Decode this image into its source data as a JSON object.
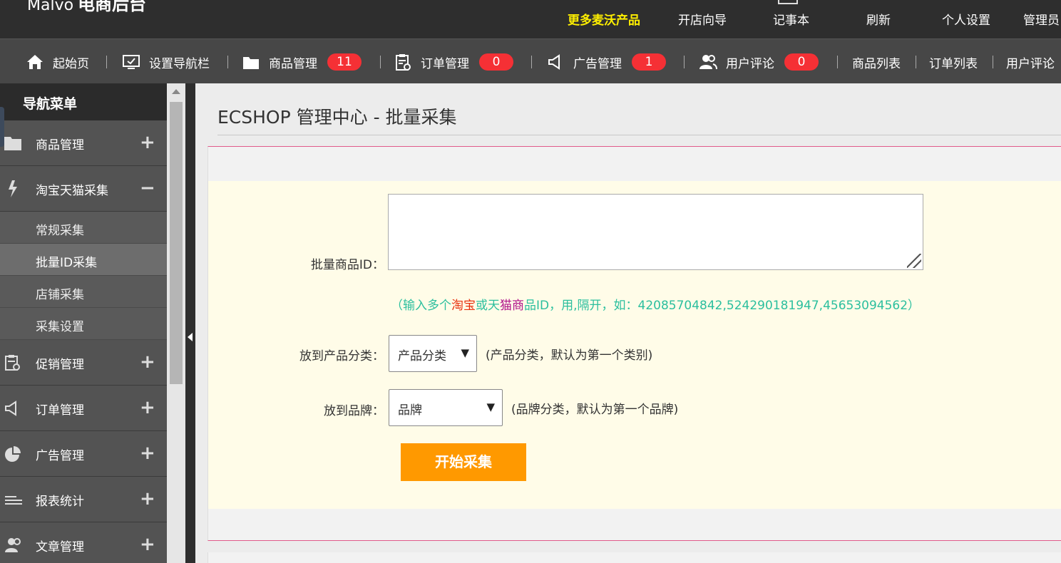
{
  "topbar": {
    "logo_text": "Malvo",
    "logo_brand": "电商后台",
    "nav": [
      {
        "label": "更多麦沃产品",
        "highlight": true
      },
      {
        "label": "开店向导"
      },
      {
        "label": "记事本"
      },
      {
        "label": "刷新"
      },
      {
        "label": "个人设置"
      },
      {
        "label": "管理员"
      }
    ]
  },
  "subbar": {
    "items": [
      {
        "label": "起始页",
        "icon": "home-icon"
      },
      {
        "label": "设置导航栏",
        "icon": "monitor-check-icon"
      },
      {
        "label": "商品管理",
        "icon": "folder-icon",
        "badge": "11"
      },
      {
        "label": "订单管理",
        "icon": "clipboard-icon",
        "badge": "0"
      },
      {
        "label": "广告管理",
        "icon": "megaphone-icon",
        "badge": "1"
      },
      {
        "label": "用户评论",
        "icon": "users-icon",
        "badge": "0"
      },
      {
        "label": "商品列表"
      },
      {
        "label": "订单列表"
      },
      {
        "label": "用户评论"
      }
    ]
  },
  "sidebar": {
    "title": "导航菜单",
    "groups": [
      {
        "label": "商品管理",
        "icon": "folder-icon",
        "toggle": "+"
      },
      {
        "label": "淘宝天猫采集",
        "icon": "lightning-icon",
        "toggle": "−",
        "children": [
          {
            "label": "常规采集"
          },
          {
            "label": "批量ID采集",
            "active": true
          },
          {
            "label": "店铺采集"
          },
          {
            "label": "采集设置"
          }
        ]
      },
      {
        "label": "促销管理",
        "icon": "clipboard-icon",
        "toggle": "+"
      },
      {
        "label": "订单管理",
        "icon": "megaphone-icon",
        "toggle": "+"
      },
      {
        "label": "广告管理",
        "icon": "pie-icon",
        "toggle": "+"
      },
      {
        "label": "报表统计",
        "icon": "lines-icon",
        "toggle": "+"
      },
      {
        "label": "文章管理",
        "icon": "users-icon",
        "toggle": "+"
      }
    ]
  },
  "main": {
    "title": "ECSHOP 管理中心 - 批量采集",
    "form": {
      "ids_label": "批量商品ID：",
      "ids_value": "",
      "hint_prefix": "（输入多个",
      "hint_taobao": "淘宝",
      "hint_or": "或天",
      "hint_tmall": "猫商",
      "hint_suffix": "品ID，用,隔开，如：42085704842,524290181947,45653094562）",
      "category_label": "放到产品分类：",
      "category_value": "产品分类",
      "category_note": "(产品分类，默认为第一个类别)",
      "brand_label": "放到品牌：",
      "brand_value": "品牌",
      "brand_note": "(品牌分类，默认为第一个品牌)",
      "submit_label": "开始采集"
    }
  },
  "colors": {
    "topbar_bg": "#2e2e2e",
    "subbar_bg": "#474747",
    "highlight_yellow": "#ffef00",
    "badge_red": "#f53035",
    "hint_green": "#2bbf9e",
    "button_orange": "#ff9900",
    "form_bg": "#fffce8"
  }
}
